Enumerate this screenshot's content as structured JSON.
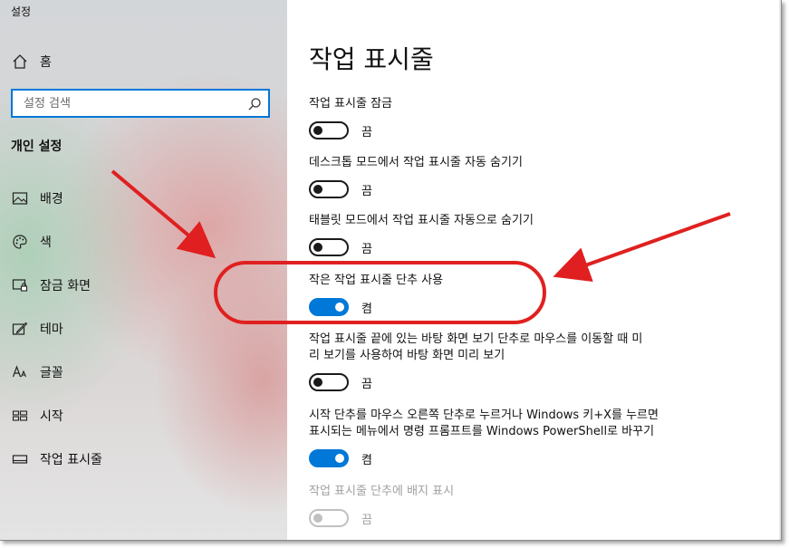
{
  "app_title": "설정",
  "sidebar": {
    "home_label": "홈",
    "search": {
      "placeholder": "설정 검색"
    },
    "section_header": "개인 설정",
    "items": [
      {
        "label": "배경",
        "icon": "background-image-icon"
      },
      {
        "label": "색",
        "icon": "palette-icon"
      },
      {
        "label": "잠금 화면",
        "icon": "lock-screen-icon"
      },
      {
        "label": "테마",
        "icon": "theme-icon"
      },
      {
        "label": "글꼴",
        "icon": "font-icon"
      },
      {
        "label": "시작",
        "icon": "start-icon"
      },
      {
        "label": "작업 표시줄",
        "icon": "taskbar-icon"
      }
    ]
  },
  "main": {
    "title": "작업 표시줄",
    "settings": [
      {
        "label": "작업 표시줄 잠금",
        "state": "끔",
        "on": false,
        "disabled": false
      },
      {
        "label": "데스크톱 모드에서 작업 표시줄 자동 숨기기",
        "state": "끔",
        "on": false,
        "disabled": false
      },
      {
        "label": "태블릿 모드에서 작업 표시줄 자동으로 숨기기",
        "state": "끔",
        "on": false,
        "disabled": false
      },
      {
        "label": "작은 작업 표시줄 단추 사용",
        "state": "켬",
        "on": true,
        "disabled": false
      },
      {
        "label_line1": "작업 표시줄 끝에 있는 바탕 화면 보기 단추로 마우스를 이동할 때 미",
        "label_line2": "리 보기를 사용하여 바탕 화면 미리 보기",
        "state": "끔",
        "on": false,
        "disabled": false
      },
      {
        "label_line1": "시작 단추를 마우스 오른쪽 단추로 누르거나 Windows 키+X를 누르면",
        "label_line2": "표시되는 메뉴에서 명령 프롬프트를 Windows PowerShell로 바꾸기",
        "state": "켬",
        "on": true,
        "disabled": false
      },
      {
        "label": "작업 표시줄 단추에 배지 표시",
        "state": "끔",
        "on": false,
        "disabled": true
      }
    ]
  },
  "colors": {
    "accent": "#0078d7",
    "annotation": "#e02020"
  }
}
